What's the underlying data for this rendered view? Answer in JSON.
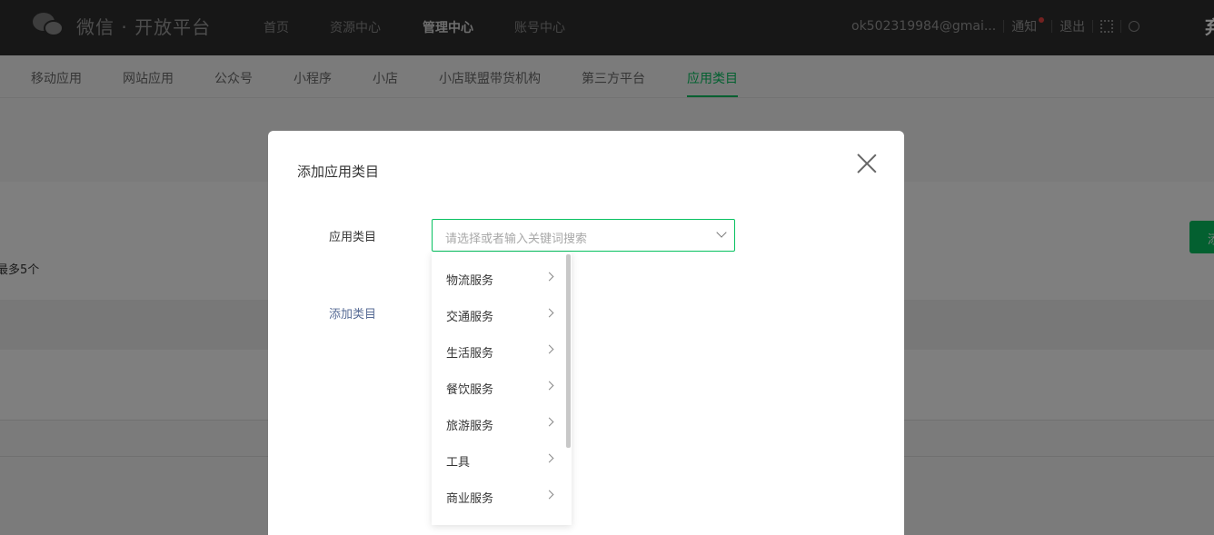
{
  "header": {
    "logo_text": "微信 · 开放平台",
    "nav": [
      "首页",
      "资源中心",
      "管理中心",
      "账号中心"
    ],
    "account": "ok502319984@gmai...",
    "notice": "通知",
    "logout": "退出",
    "edge_char": "弃"
  },
  "subnav": {
    "tabs": [
      "移动应用",
      "网站应用",
      "公众号",
      "小程序",
      "小店",
      "小店联盟带货机构",
      "第三方平台",
      "应用类目"
    ]
  },
  "background": {
    "hint_text": "最多5个",
    "green_button": "添"
  },
  "modal": {
    "title": "添加应用类目",
    "field_label": "应用类目",
    "select_placeholder": "请选择或者输入关键词搜索",
    "add_link": "添加类目",
    "dropdown_items": [
      "物流服务",
      "交通服务",
      "生活服务",
      "餐饮服务",
      "旅游服务",
      "工具",
      "商业服务"
    ]
  },
  "colors": {
    "accent": "#07c160",
    "link": "#576b95",
    "header_bg": "#2e2e2e"
  }
}
